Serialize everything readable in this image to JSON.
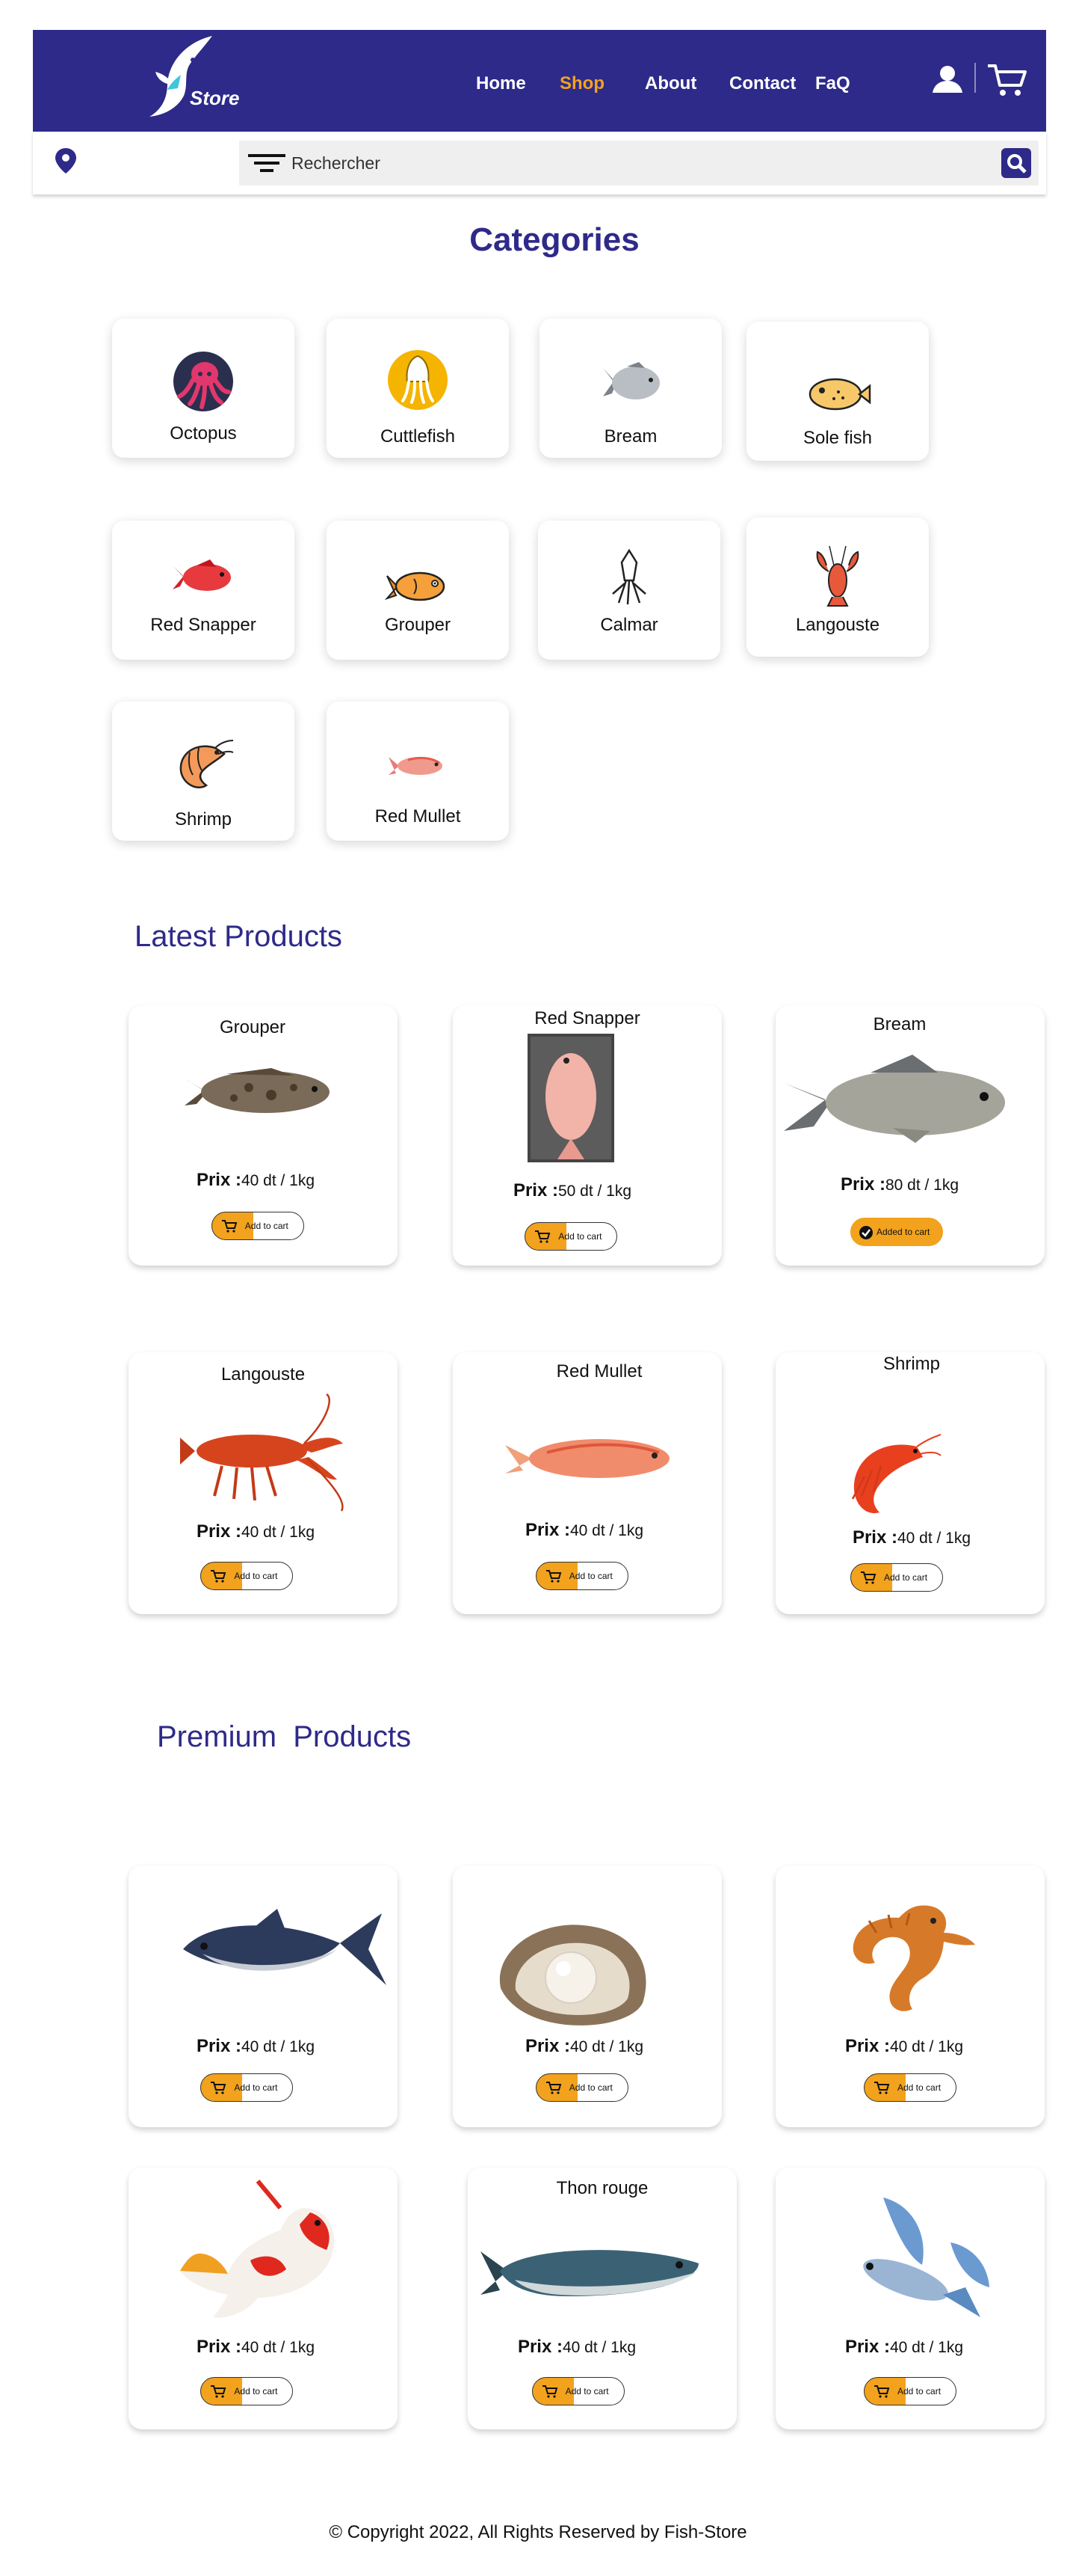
{
  "header": {
    "logo_text": "Store",
    "nav": [
      "Home",
      "Shop",
      "About",
      "Contact",
      "FaQ"
    ],
    "active_nav": "Shop",
    "colors": {
      "brand": "#2e2a8a",
      "accent": "#f2a21d"
    }
  },
  "search": {
    "placeholder": "Rechercher"
  },
  "categories": {
    "title": "Categories",
    "items": [
      "Octopus",
      "Cuttlefish",
      "Bream",
      "Sole fish",
      "Red Snapper",
      "Grouper",
      "Calmar",
      "Langouste",
      "Shrimp",
      "Red Mullet"
    ]
  },
  "latest": {
    "title": "Latest Products",
    "products": [
      {
        "name": "Grouper",
        "prix_label": "Prix :",
        "price": "40 dt / 1kg",
        "button": "Add to cart",
        "added": false
      },
      {
        "name": "Red Snapper",
        "prix_label": "Prix :",
        "price": "50 dt / 1kg",
        "button": "Add to cart",
        "added": false
      },
      {
        "name": "Bream",
        "prix_label": "Prix :",
        "price": "80 dt / 1kg",
        "button": "Added to cart",
        "added": true
      },
      {
        "name": "Langouste",
        "prix_label": "Prix :",
        "price": "40 dt / 1kg",
        "button": "Add to cart",
        "added": false
      },
      {
        "name": "Red Mullet",
        "prix_label": "Prix :",
        "price": "40 dt / 1kg",
        "button": "Add to cart",
        "added": false
      },
      {
        "name": "Shrimp",
        "prix_label": "Prix :",
        "price": "40 dt / 1kg",
        "button": "Add to cart",
        "added": false
      }
    ]
  },
  "premium": {
    "title": "Premium  Products",
    "products": [
      {
        "name": "",
        "prix_label": "Prix :",
        "price": "40 dt / 1kg",
        "button": "Add to cart"
      },
      {
        "name": "",
        "prix_label": "Prix :",
        "price": "40 dt / 1kg",
        "button": "Add to cart"
      },
      {
        "name": "",
        "prix_label": "Prix :",
        "price": "40 dt / 1kg",
        "button": "Add to cart"
      },
      {
        "name": "",
        "prix_label": "Prix :",
        "price": "40 dt / 1kg",
        "button": "Add to cart"
      },
      {
        "name": "Thon rouge",
        "prix_label": "Prix :",
        "price": "40 dt / 1kg",
        "button": "Add to cart"
      },
      {
        "name": "",
        "prix_label": "Prix :",
        "price": "40 dt / 1kg",
        "button": "Add to cart"
      }
    ]
  },
  "footer": {
    "text": "© Copyright 2022, All Rights Reserved by Fish-Store"
  }
}
